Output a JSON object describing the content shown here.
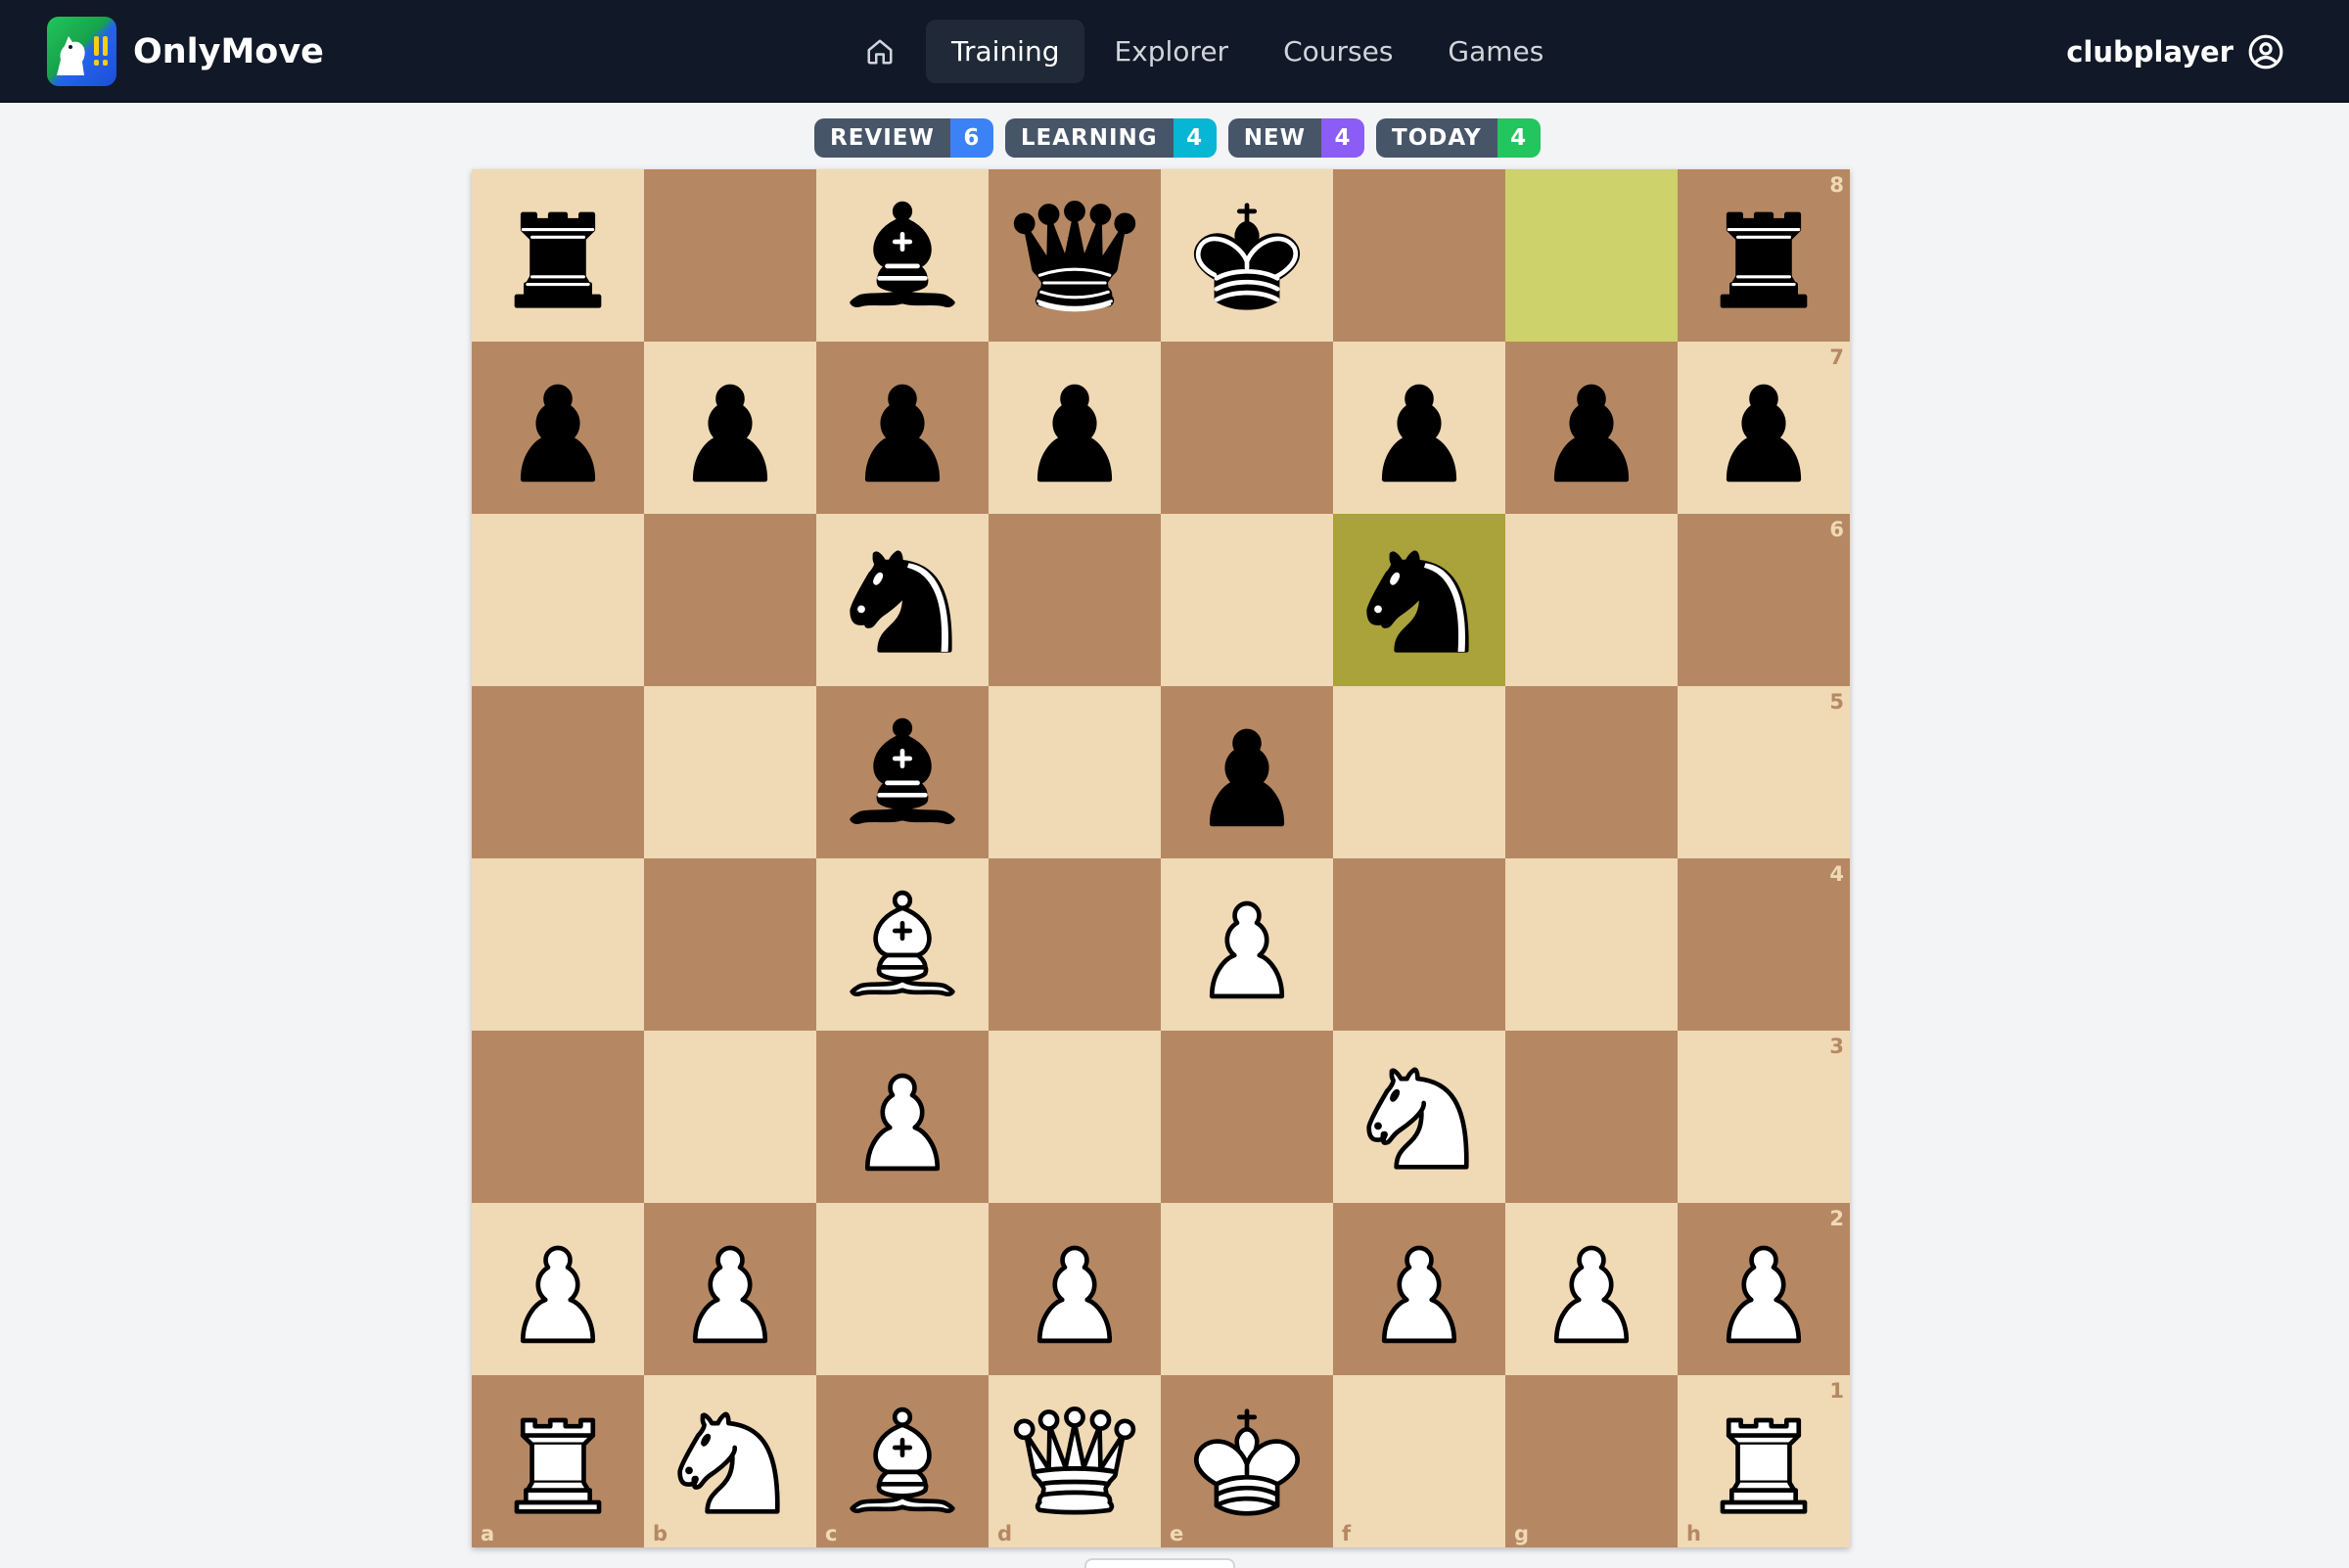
{
  "app": {
    "name": "OnlyMove"
  },
  "nav": {
    "home_icon": "home-icon",
    "links": [
      {
        "label": "Training",
        "active": true
      },
      {
        "label": "Explorer",
        "active": false
      },
      {
        "label": "Courses",
        "active": false
      },
      {
        "label": "Games",
        "active": false
      }
    ]
  },
  "user": {
    "name": "clubplayer",
    "icon": "user-circle-icon"
  },
  "counters": [
    {
      "label": "REVIEW",
      "value": "6",
      "color": "#3b82f6"
    },
    {
      "label": "LEARNING",
      "value": "4",
      "color": "#06b6d4"
    },
    {
      "label": "NEW",
      "value": "4",
      "color": "#8b5cf6"
    },
    {
      "label": "TODAY",
      "value": "4",
      "color": "#22c55e"
    }
  ],
  "board": {
    "orientation": "white",
    "fen": "r1bqk2r/pppp1ppp/2n2n2/2b1p3/2B1P3/2P2N2/PP1P1PPP/RNBQK2R",
    "last_move": {
      "from": "g8",
      "to": "f6"
    },
    "colors": {
      "light": "#f0d9b5",
      "dark": "#b58863",
      "highlight_light": "#cdd26a",
      "highlight_dark": "#aaa23a"
    },
    "files": [
      "a",
      "b",
      "c",
      "d",
      "e",
      "f",
      "g",
      "h"
    ],
    "ranks": [
      "8",
      "7",
      "6",
      "5",
      "4",
      "3",
      "2",
      "1"
    ]
  }
}
